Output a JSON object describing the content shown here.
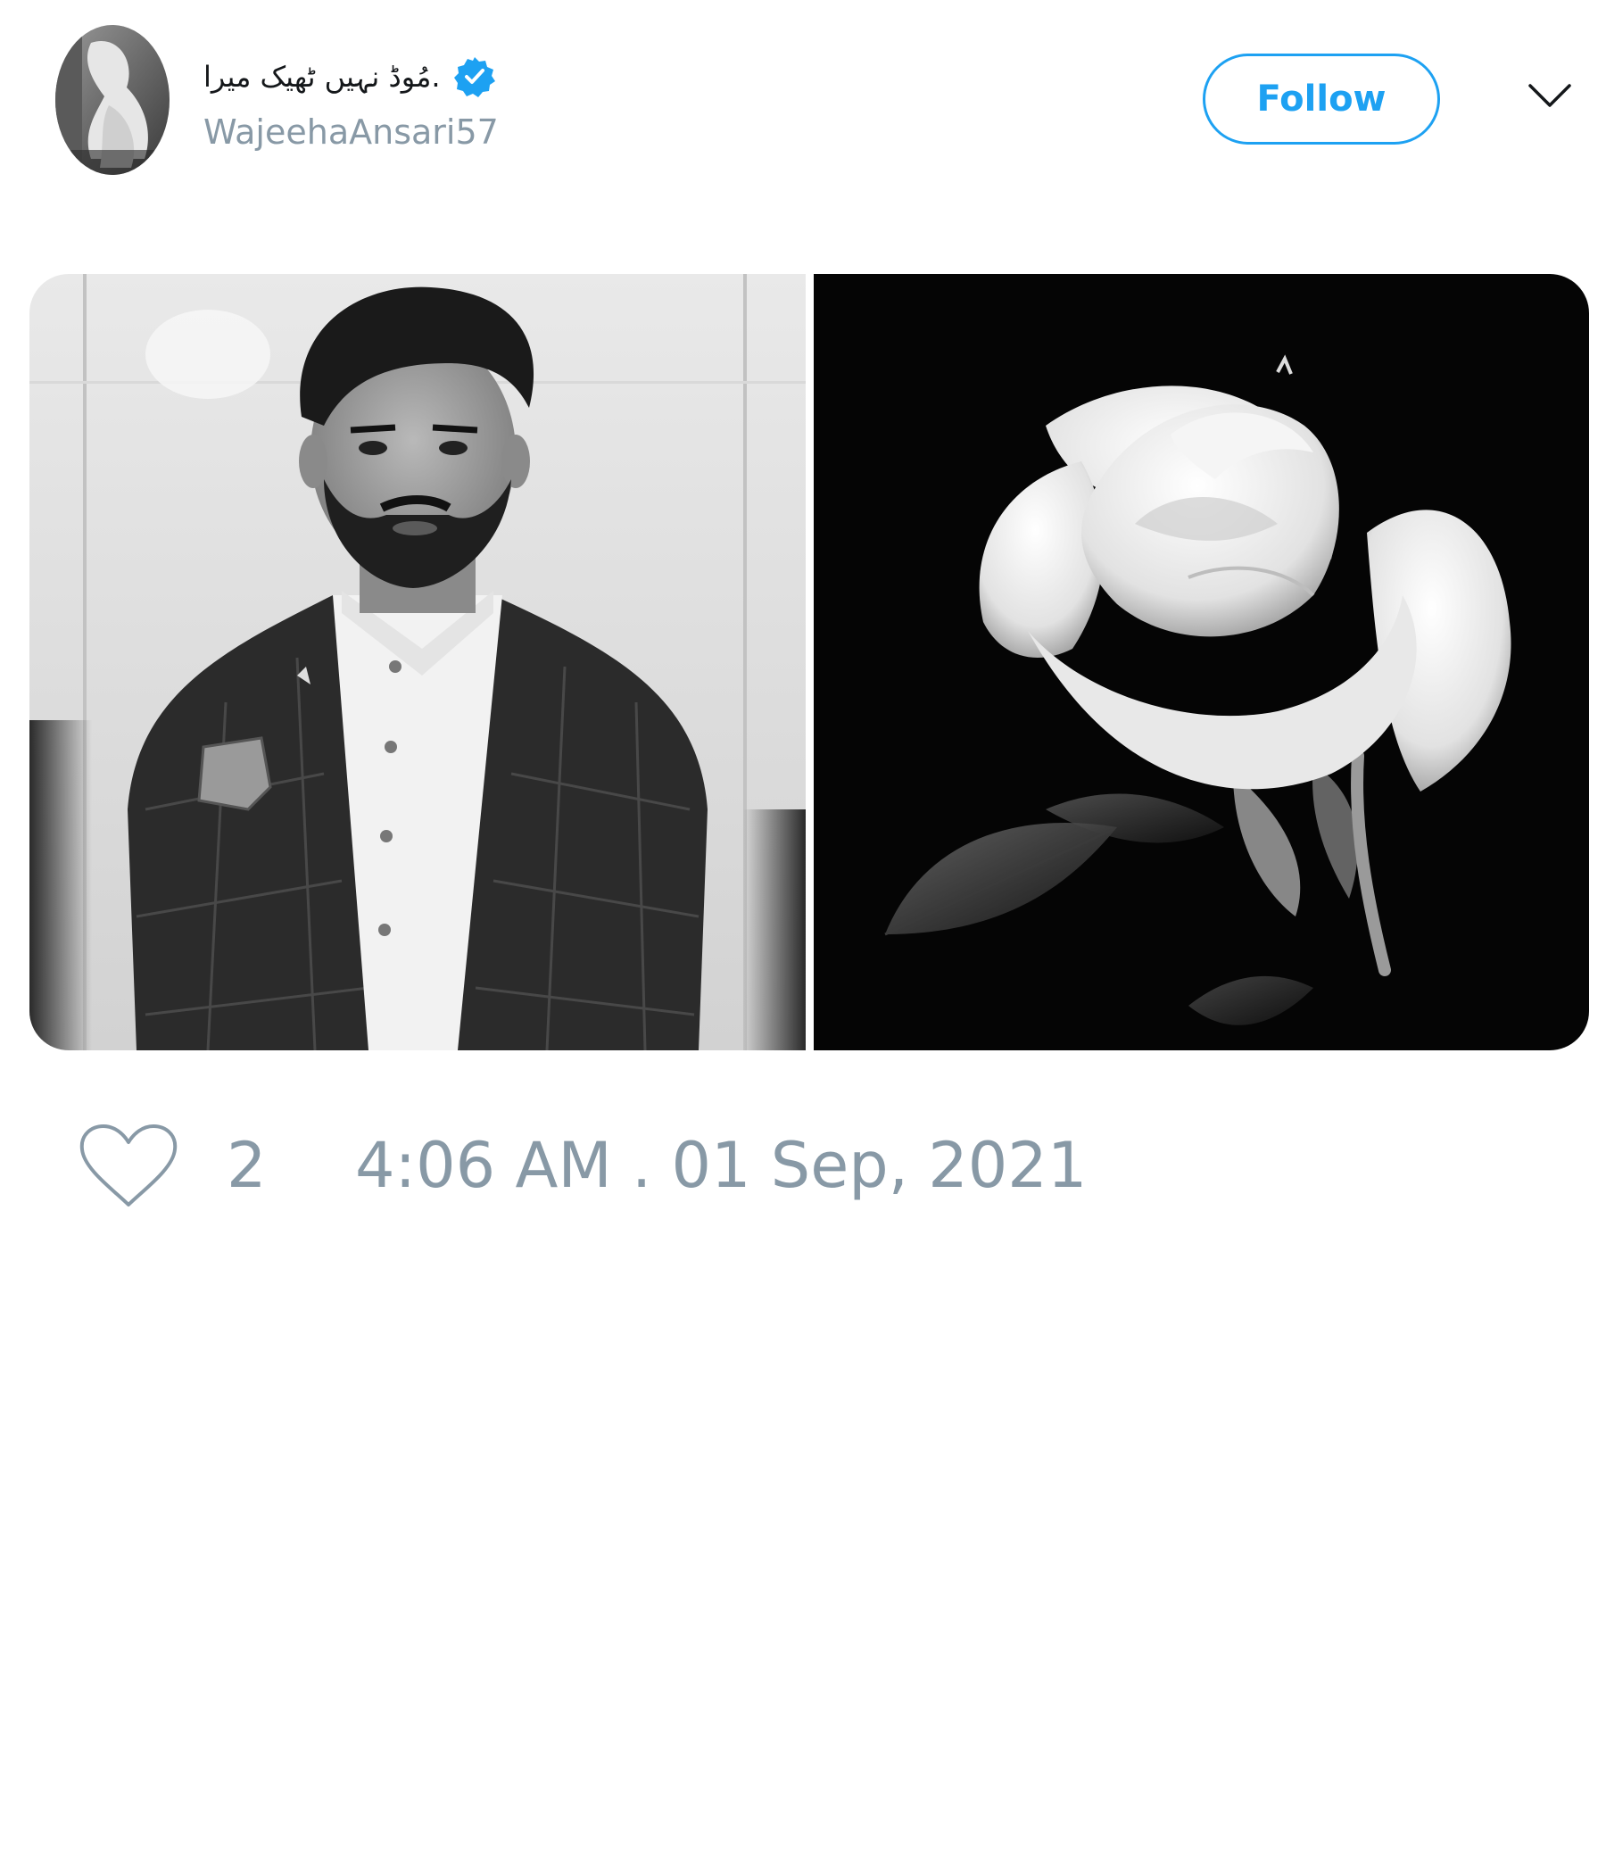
{
  "tweet": {
    "author": {
      "display_name": ".مُوڈ نہیں ٹھیک میرا",
      "username": "WajeehaAnsari57",
      "verified": true,
      "avatar_icon": "profile-photo"
    },
    "follow_label": "Follow",
    "menu_icon": "chevron-down-icon",
    "media": [
      {
        "description_icon": "portrait-photo"
      },
      {
        "description_icon": "white-rose-photo"
      }
    ],
    "like_count": "2",
    "timestamp": "4:06 AM . 01 Sep, 2021"
  },
  "colors": {
    "accent": "#1da1f2",
    "muted_text": "#8899a6",
    "primary_text": "#14171a",
    "background": "#ffffff"
  }
}
